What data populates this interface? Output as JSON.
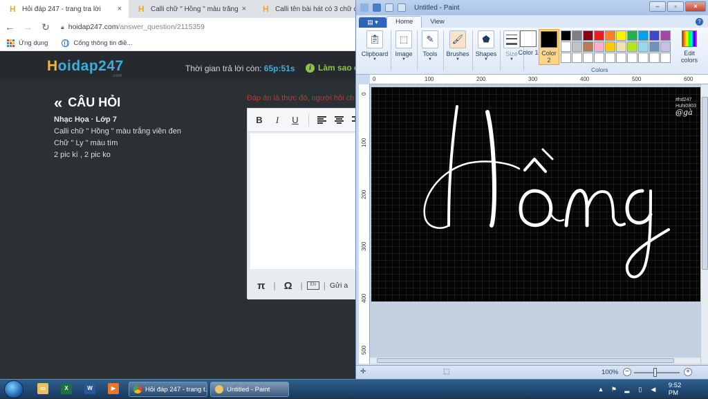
{
  "browser": {
    "tabs": [
      {
        "title": "Hỏi đáp 247 - trang tra lời",
        "active": true
      },
      {
        "title": "Calli chữ \" Hồng \" màu trắng viền",
        "active": false
      },
      {
        "title": "Calli tên bài hát có 3 chữ cái h",
        "active": false
      }
    ],
    "close_glyph": "×",
    "url_host": "hoidap247.com",
    "url_path": "/answer_question/2115359",
    "bookmarks": [
      {
        "label": "Ứng dụng",
        "icon": "apps-icon"
      },
      {
        "label": "Cổng thông tin điề...",
        "icon": "globe-icon"
      }
    ]
  },
  "site": {
    "logo_h": "H",
    "logo_rest": "oidap247",
    "logo_suffix": ".com",
    "timer_label": "Thời gian trả lời còn:",
    "timer_value": "65p:51s",
    "help_link": "Làm sao đ",
    "question_heading": "CÂU HỎI",
    "question_meta": "Nhạc Họa · Lớp 7",
    "question_lines": [
      "Calli chữ \" Hồng \" màu trắng viền đen",
      "Chữ \" Ly \" màu tím",
      "2 pic kí , 2 pic ko"
    ],
    "answer_hint": "Đáp án là thực đó, người hỏi ch",
    "editor": {
      "bold": "B",
      "italic": "I",
      "underline": "U",
      "pi": "π",
      "omega": "Ω",
      "kbd": "EN",
      "send_label": "Gửi a"
    }
  },
  "paint": {
    "title": "Untitled - Paint",
    "tabs": [
      "Home",
      "View"
    ],
    "groups": [
      "Clipboard",
      "Image",
      "Tools",
      "Brushes",
      "Shapes",
      "Size"
    ],
    "color1_label": "Color 1",
    "color2_label": "Color 2",
    "colors_label": "Colors",
    "edit_colors_label": "Edit colors",
    "palette": [
      "#000000",
      "#7f7f7f",
      "#880015",
      "#ed1c24",
      "#ff7f27",
      "#fff200",
      "#22b14c",
      "#00a2e8",
      "#3f48cc",
      "#a349a4",
      "#ffffff",
      "#c3c3c3",
      "#b97a57",
      "#ffaec9",
      "#ffc90e",
      "#efe4b0",
      "#b5e61d",
      "#99d9ea",
      "#7092be",
      "#c8bfe7",
      "#ffffff",
      "#ffffff",
      "#ffffff",
      "#ffffff",
      "#ffffff",
      "#ffffff",
      "#ffffff",
      "#ffffff",
      "#ffffff",
      "#ffffff"
    ],
    "color1": "#ffffff",
    "color2": "#000000",
    "ruler_h": [
      "0",
      "100",
      "200",
      "300",
      "400",
      "500",
      "600"
    ],
    "ruler_v": [
      "0",
      "100",
      "200",
      "300",
      "400",
      "500"
    ],
    "canvas_text": "Hồng",
    "watermark_lines": [
      "#hd247",
      "Huhi0803"
    ],
    "watermark_sig": "@gà",
    "zoom": "100%"
  },
  "taskbar": {
    "tasks": [
      {
        "label": "Hỏi đáp 247 - trang t..."
      },
      {
        "label": "Untitled - Paint"
      }
    ],
    "clock": "9:52 PM"
  }
}
